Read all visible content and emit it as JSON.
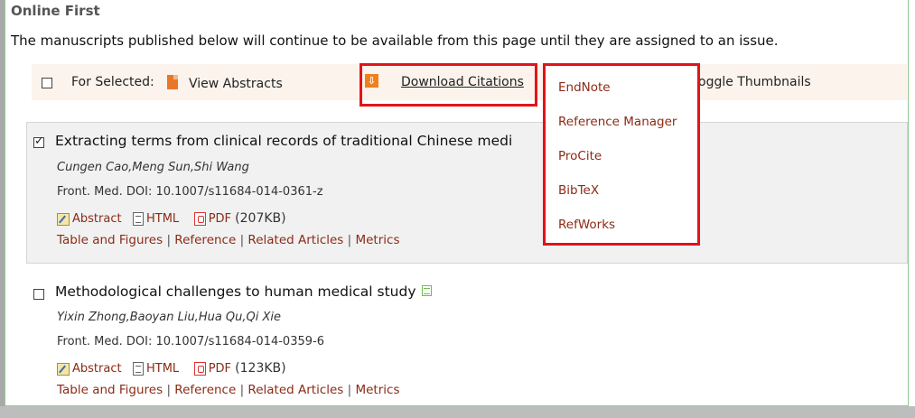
{
  "section": {
    "title": "Online First",
    "intro": "The manuscripts published below will continue to be available from this page until they are assigned to an issue."
  },
  "toolbar": {
    "for_selected": "For Selected:",
    "view_abstracts": "View Abstracts",
    "download_citations": "Download Citations",
    "toggle_thumbnails": "oggle Thumbnails"
  },
  "citation_menu": {
    "items": [
      "EndNote",
      "Reference Manager",
      "ProCite",
      "BibTeX",
      "RefWorks"
    ]
  },
  "articles": [
    {
      "checked": true,
      "title": "Extracting terms from clinical records of traditional Chinese medi",
      "authors": "Cungen Cao,Meng Sun,Shi Wang",
      "meta": "Front. Med.    DOI: 10.1007/s11684-014-0361-z",
      "abstract": "Abstract",
      "html": "HTML",
      "pdf": "PDF",
      "pdf_size": "(207KB)",
      "links": [
        "Table and Figures",
        "Reference",
        "Related Articles",
        "Metrics"
      ]
    },
    {
      "checked": false,
      "title": "Methodological challenges to human medical study",
      "authors": "Yixin Zhong,Baoyan Liu,Hua Qu,Qi Xie",
      "meta": "Front. Med.    DOI: 10.1007/s11684-014-0359-6",
      "abstract": "Abstract",
      "html": "HTML",
      "pdf": "PDF",
      "pdf_size": "(123KB)",
      "links": [
        "Table and Figures",
        "Reference",
        "Related Articles",
        "Metrics"
      ]
    }
  ],
  "colors": {
    "link": "#8b2b16",
    "highlight_box": "#e3131b",
    "toolbar_bg": "#fbf3ec",
    "article_bg": "#f1f1f1"
  }
}
